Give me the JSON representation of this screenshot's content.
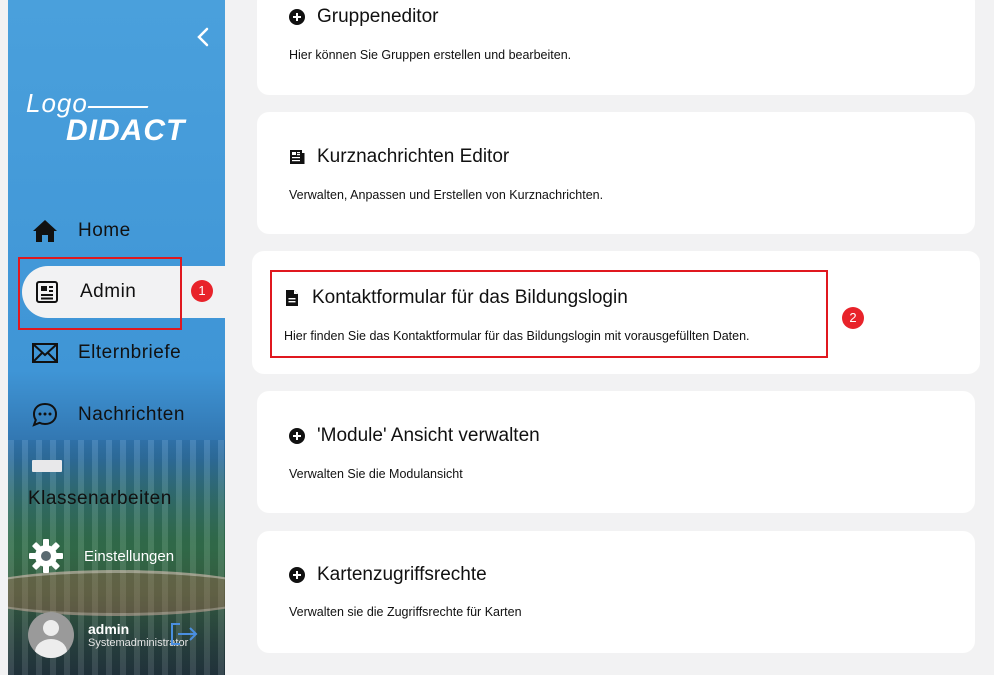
{
  "sidebar": {
    "logo": {
      "line1": "Logo",
      "line2": "DIDACT"
    },
    "items": [
      {
        "label": "Home",
        "icon": "home-icon"
      },
      {
        "label": "Admin",
        "icon": "newspaper-icon"
      },
      {
        "label": "Elternbriefe",
        "icon": "envelope-icon"
      },
      {
        "label": "Nachrichten",
        "icon": "chat-bubble-icon"
      }
    ],
    "klassenarbeiten": "Klassenarbeiten",
    "settings": "Einstellungen",
    "user": {
      "name": "admin",
      "role": "Systemadministrator"
    }
  },
  "annotations": {
    "n1": "1",
    "n2": "2",
    "color": "#e0181f"
  },
  "cards": [
    {
      "title": "Gruppeneditor",
      "desc": "Hier können Sie Gruppen erstellen und bearbeiten.",
      "icon": "plus-circle-icon"
    },
    {
      "title": "Kurznachrichten Editor",
      "desc": "Verwalten, Anpassen und Erstellen von Kurznachrichten.",
      "icon": "newspaper-icon"
    },
    {
      "title": "Kontaktformular für das Bildungslogin",
      "desc": "Hier finden Sie das Kontaktformular für das Bildungslogin mit vorausgefüllten Daten.",
      "icon": "document-icon"
    },
    {
      "title": "'Module' Ansicht verwalten",
      "desc": "Verwalten Sie die Modulansicht",
      "icon": "plus-circle-icon"
    },
    {
      "title": "Kartenzugriffsrechte",
      "desc": "Verwalten sie die Zugriffsrechte für Karten",
      "icon": "plus-circle-icon"
    }
  ],
  "colors": {
    "sidebar": "#4aa0dc",
    "background": "#f2f2f3",
    "accent": "#4a8fe0"
  }
}
